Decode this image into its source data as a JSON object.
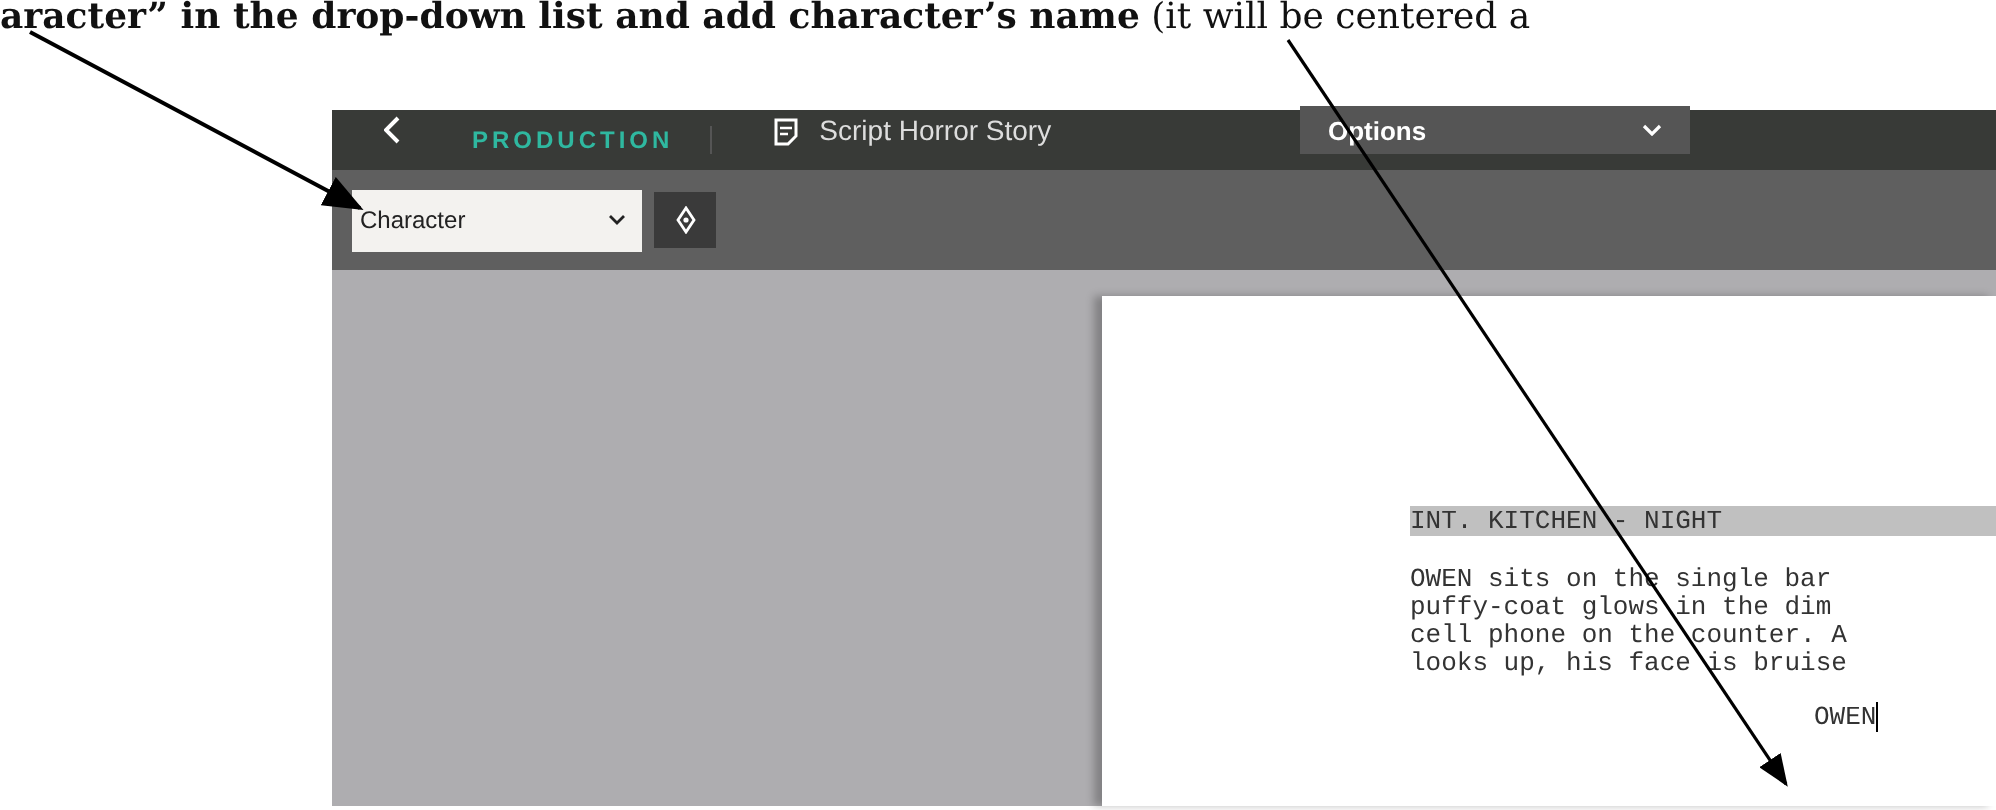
{
  "instruction": "**aracter” in the drop-down list and add character’s name** (it will be centered a",
  "header": {
    "section": "PRODUCTION",
    "document_title": "Script Horror Story",
    "menu": "Options"
  },
  "toolbar": {
    "element_type": "Character"
  },
  "script": {
    "scene_heading": "INT. KITCHEN - NIGHT",
    "action_lines": [
      "OWEN sits on the single bar",
      "puffy-coat glows in the dim",
      "cell phone on the counter. A",
      "looks up, his face is bruise"
    ],
    "character": "OWEN"
  }
}
